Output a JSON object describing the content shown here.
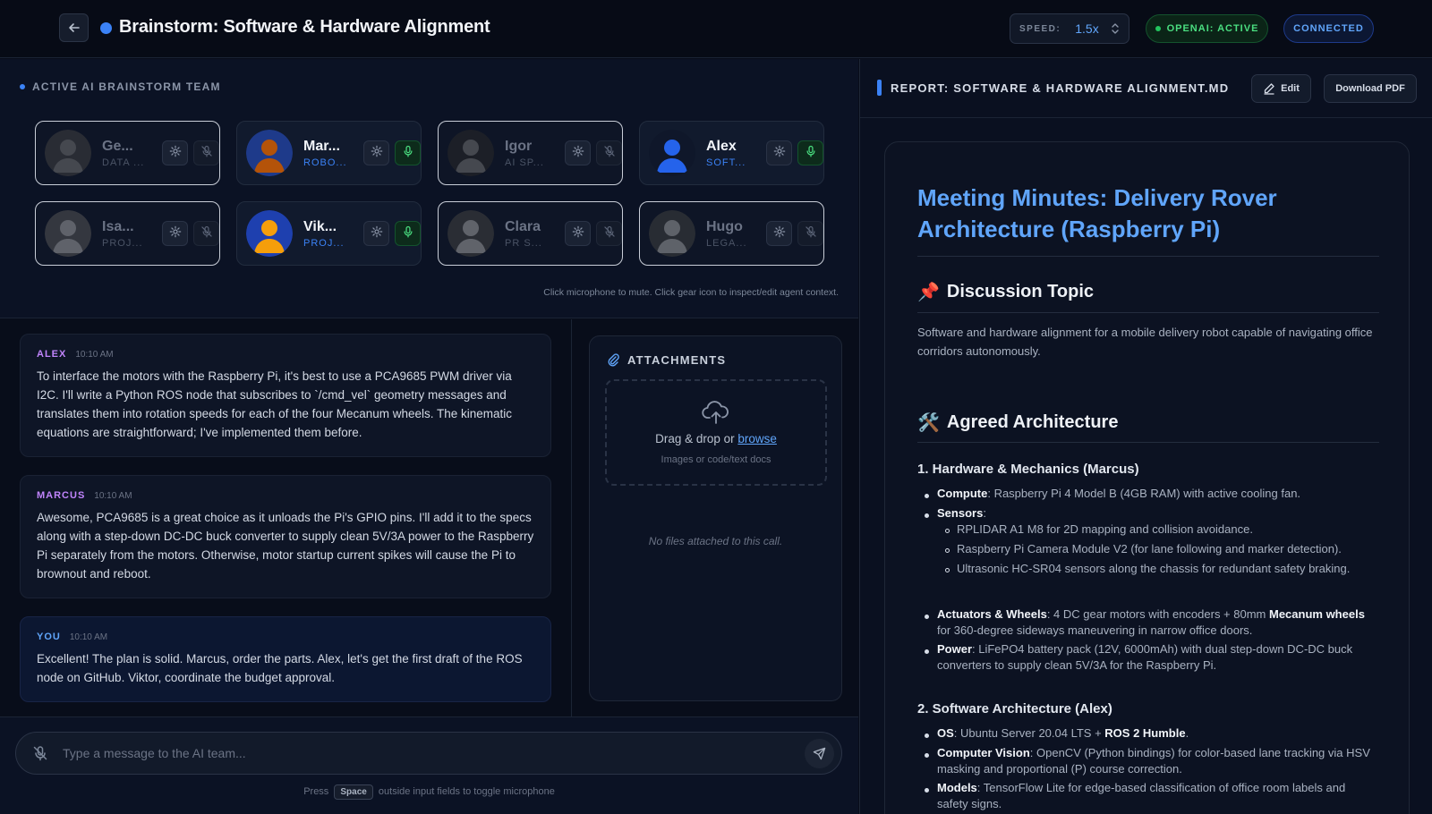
{
  "header": {
    "title": "Brainstorm: Software & Hardware Alignment",
    "speed_label": "SPEED:",
    "speed_value": "1.5x",
    "openai_status": "OPENAI: ACTIVE",
    "connection_status": "CONNECTED"
  },
  "team": {
    "heading": "ACTIVE AI BRAINSTORM TEAM",
    "hint": "Click microphone to mute. Click gear icon to inspect/edit agent context.",
    "agents": [
      {
        "name": "Ge...",
        "role": "DATA ...",
        "state": "muted"
      },
      {
        "name": "Mar...",
        "role": "ROBO...",
        "state": "active"
      },
      {
        "name": "Igor",
        "role": "AI SP...",
        "state": "muted"
      },
      {
        "name": "Alex",
        "role": "SOFT...",
        "state": "active"
      },
      {
        "name": "Isa...",
        "role": "PROJ...",
        "state": "muted"
      },
      {
        "name": "Vik...",
        "role": "PROJ...",
        "state": "active"
      },
      {
        "name": "Clara",
        "role": "PR S...",
        "state": "muted"
      },
      {
        "name": "Hugo",
        "role": "LEGA...",
        "state": "muted"
      }
    ]
  },
  "messages": [
    {
      "author": "ALEX",
      "time": "10:10 AM",
      "text": "To interface the motors with the Raspberry Pi, it's best to use a PCA9685 PWM driver via I2C. I'll write a Python ROS node that subscribes to `/cmd_vel` geometry messages and translates them into rotation speeds for each of the four Mecanum wheels. The kinematic equations are straightforward; I've implemented them before."
    },
    {
      "author": "MARCUS",
      "time": "10:10 AM",
      "text": "Awesome, PCA9685 is a great choice as it unloads the Pi's GPIO pins. I'll add it to the specs along with a step-down DC-DC buck converter to supply clean 5V/3A power to the Raspberry Pi separately from the motors. Otherwise, motor startup current spikes will cause the Pi to brownout and reboot."
    },
    {
      "author": "YOU",
      "time": "10:10 AM",
      "text": "Excellent! The plan is solid. Marcus, order the parts. Alex, let's get the first draft of the ROS node on GitHub. Viktor, coordinate the budget approval."
    }
  ],
  "attachments": {
    "title": "ATTACHMENTS",
    "drop_text": "Drag & drop or ",
    "browse_text": "browse",
    "drop_hint": "Images or code/text docs",
    "empty_text": "No files attached to this call."
  },
  "composer": {
    "placeholder": "Type a message to the AI team...",
    "hint_before": "Press",
    "hint_key": "Space",
    "hint_after": "outside input fields to toggle microphone"
  },
  "report": {
    "title": "REPORT: SOFTWARE & HARDWARE ALIGNMENT.MD",
    "edit_label": "Edit",
    "download_label": "Download PDF",
    "h1": "Meeting Minutes: Delivery Rover Architecture (Raspberry Pi)",
    "topic_emoji": "📌",
    "topic_heading": "Discussion Topic",
    "topic_text": "Software and hardware alignment for a mobile delivery robot capable of navigating office corridors autonomously.",
    "arch_emoji": "🛠️",
    "arch_heading": "Agreed Architecture",
    "hw_heading": "1. Hardware & Mechanics (Marcus)",
    "hw": {
      "compute_label": "Compute",
      "compute_text": ": Raspberry Pi 4 Model B (4GB RAM) with active cooling fan.",
      "sensors_label": "Sensors",
      "sensors_text": ":",
      "sensor_items": [
        "RPLIDAR A1 M8 for 2D mapping and collision avoidance.",
        "Raspberry Pi Camera Module V2 (for lane following and marker detection).",
        "Ultrasonic HC-SR04 sensors along the chassis for redundant safety braking."
      ],
      "actuators_label": "Actuators & Wheels",
      "actuators_text_a": ": 4 DC gear motors with encoders + 80mm ",
      "actuators_bold": "Mecanum wheels",
      "actuators_text_b": " for 360-degree sideways maneuvering in narrow office doors.",
      "power_label": "Power",
      "power_text": ": LiFePO4 battery pack (12V, 6000mAh) with dual step-down DC-DC buck converters to supply clean 5V/3A for the Raspberry Pi."
    },
    "sw_heading": "2. Software Architecture (Alex)",
    "sw": {
      "os_label": "OS",
      "os_text": ": Ubuntu Server 20.04 LTS + ",
      "os_bold": "ROS 2 Humble",
      "os_end": ".",
      "cv_label": "Computer Vision",
      "cv_text": ": OpenCV (Python bindings) for color-based lane tracking via HSV masking and proportional (P) course correction.",
      "models_label": "Models",
      "models_text": ": TensorFlow Lite for edge-based classification of office room labels and safety signs."
    }
  }
}
